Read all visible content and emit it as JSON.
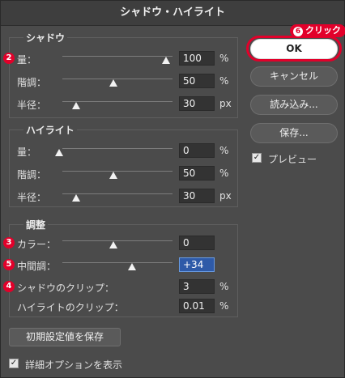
{
  "window": {
    "title": "シャドウ・ハイライト"
  },
  "shadow": {
    "title": "シャドウ",
    "amount": {
      "label": "量：",
      "value": "100",
      "unit": "%",
      "slider_fraction": 1.0
    },
    "tone": {
      "label": "階調：",
      "value": "50",
      "unit": "%",
      "slider_fraction": 0.5
    },
    "radius": {
      "label": "半径：",
      "value": "30",
      "unit": "px",
      "slider_fraction": 0.15
    }
  },
  "highlight": {
    "title": "ハイライト",
    "amount": {
      "label": "量：",
      "value": "0",
      "unit": "%",
      "slider_fraction": 0.0
    },
    "tone": {
      "label": "階調：",
      "value": "50",
      "unit": "%",
      "slider_fraction": 0.5
    },
    "radius": {
      "label": "半径：",
      "value": "30",
      "unit": "px",
      "slider_fraction": 0.15
    }
  },
  "adjust": {
    "title": "調整",
    "color": {
      "label": "カラー：",
      "value": "0",
      "slider_fraction": 0.5
    },
    "midtone": {
      "label": "中間調：",
      "value": "+34",
      "slider_fraction": 0.67
    },
    "shadow_clip": {
      "label": "シャドウのクリップ：",
      "value": "3",
      "unit": "%"
    },
    "highlight_clip": {
      "label": "ハイライトのクリップ：",
      "value": "0.01",
      "unit": "%"
    }
  },
  "buttons": {
    "ok": "OK",
    "cancel": "キャンセル",
    "load": "読み込み...",
    "save": "保存...",
    "save_defaults": "初期設定値を保存"
  },
  "preview": {
    "label": "プレビュー",
    "checked": true
  },
  "more_options": {
    "label": "詳細オプションを表示",
    "checked": true
  },
  "annotations": {
    "click_callout": {
      "number": "6",
      "text": "クリック"
    },
    "badge_amount": "2",
    "badge_color": "3",
    "badge_midtone": "5",
    "badge_shadow_clip": "4"
  },
  "colors": {
    "annotation_red": "#e2002a",
    "active_field": "#2e5aa8"
  }
}
